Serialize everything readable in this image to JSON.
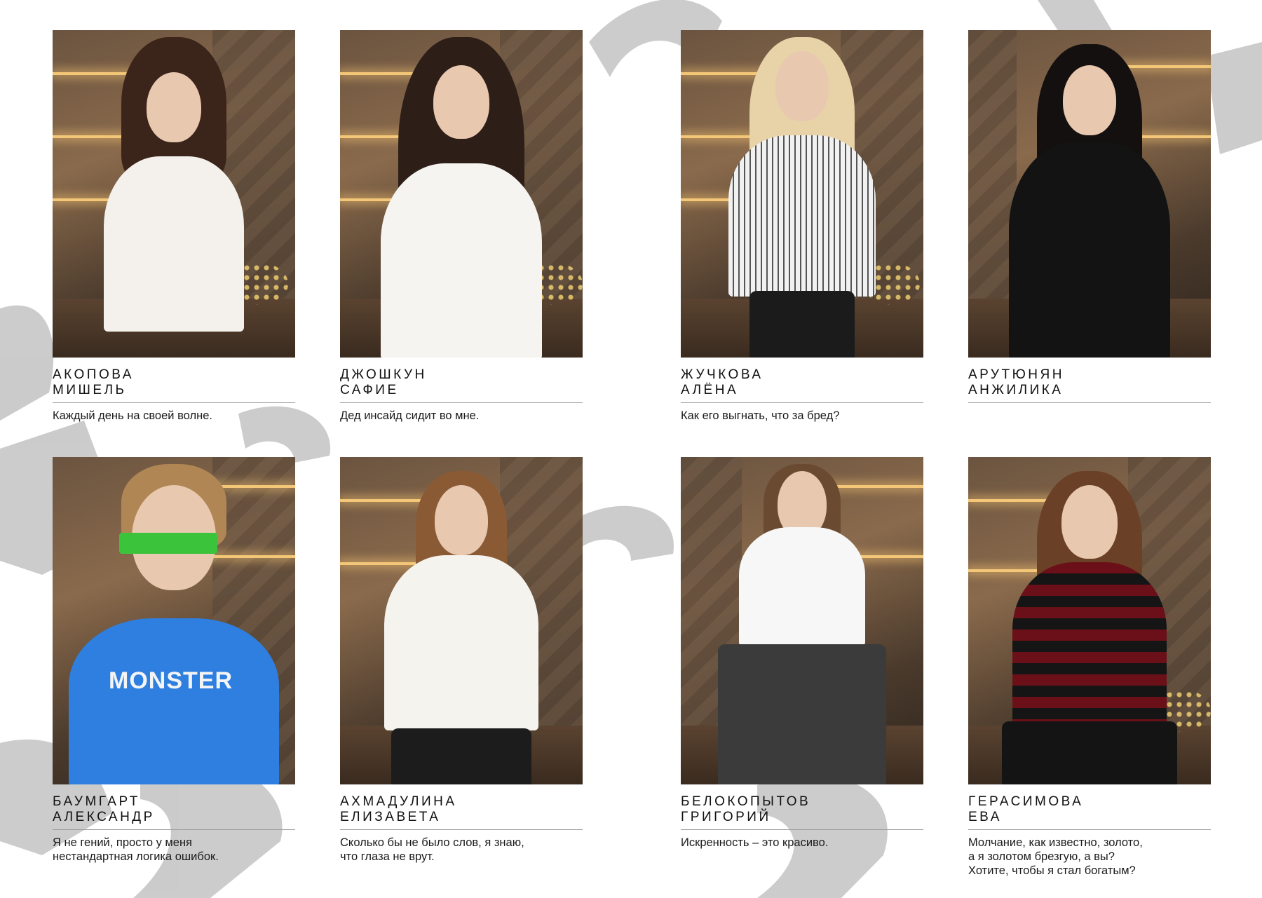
{
  "cards": [
    {
      "surname": "АКОПОВА",
      "firstname": "МИШЕЛЬ",
      "quote": "Каждый день на своей волне."
    },
    {
      "surname": "ДЖОШКУН",
      "firstname": "САФИЕ",
      "quote": "Дед инсайд сидит во мне."
    },
    {
      "surname": "ЖУЧКОВА",
      "firstname": "АЛЁНА",
      "quote": "Как его выгнать, что за бред?"
    },
    {
      "surname": "АРУТЮНЯН",
      "firstname": "АНЖИЛИКА",
      "quote": ""
    },
    {
      "surname": "БАУМГАРТ",
      "firstname": "АЛЕКСАНДР",
      "quote_lines": [
        "Я не гений, просто у меня",
        "нестандартная логика ошибок."
      ]
    },
    {
      "surname": "АХМАДУЛИНА",
      "firstname": "ЕЛИЗАВЕТА",
      "quote_lines": [
        "Сколько бы не было слов, я знаю,",
        "что глаза не врут."
      ]
    },
    {
      "surname": "БЕЛОКОПЫТОВ",
      "firstname": "ГРИГОРИЙ",
      "quote": "Искренность – это красиво."
    },
    {
      "surname": "ГЕРАСИМОВА",
      "firstname": "ЕВА",
      "quote_lines": [
        "Молчание, как известно, золото,",
        "а я золотом брезгую, а вы?",
        "Хотите, чтобы я стал богатым?"
      ]
    }
  ],
  "shirt_print": "MONSTER",
  "colors": {
    "background": "#ffffff",
    "text": "#111111",
    "rule": "#9c9c9c",
    "background_letters": "#c9c9c9"
  }
}
